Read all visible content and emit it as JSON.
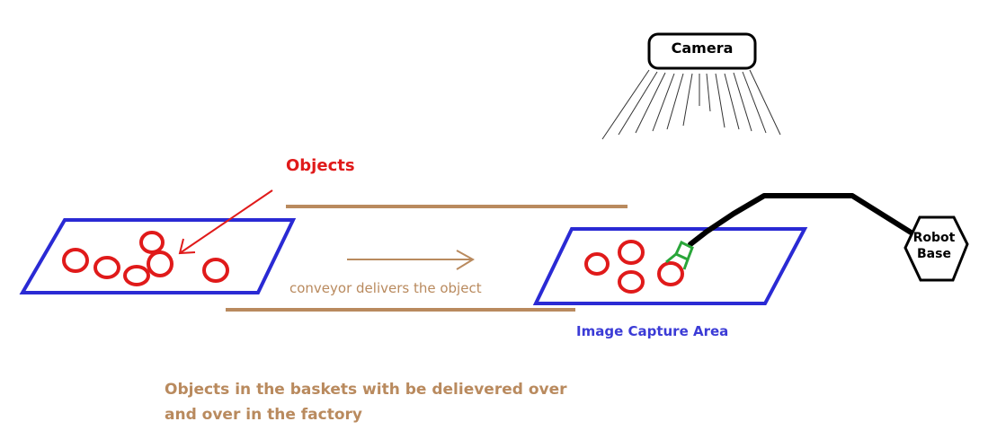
{
  "colors": {
    "conveyor": "#b98a5e",
    "basket": "#2a2ad4",
    "object": "#e01a1a",
    "label_red": "#e01a1a",
    "label_blue": "#3b3bd6",
    "label_brown": "#b98a5e",
    "gripper": "#2aa63a",
    "ink": "#000000"
  },
  "labels": {
    "camera": "Camera",
    "objects": "Objects",
    "conveyor": "conveyor delivers the object",
    "capture_area": "Image Capture Area",
    "robot_base": "Robot\nBase",
    "note_line1": "Objects in the baskets with be delievered over",
    "note_line2": "and over in the factory"
  },
  "counts": {
    "objects_in_left_basket": 6,
    "objects_in_capture_basket": 4
  },
  "icons": [
    "camera-box",
    "robot-base-hexagon",
    "gripper-icon",
    "arrow-icon"
  ]
}
